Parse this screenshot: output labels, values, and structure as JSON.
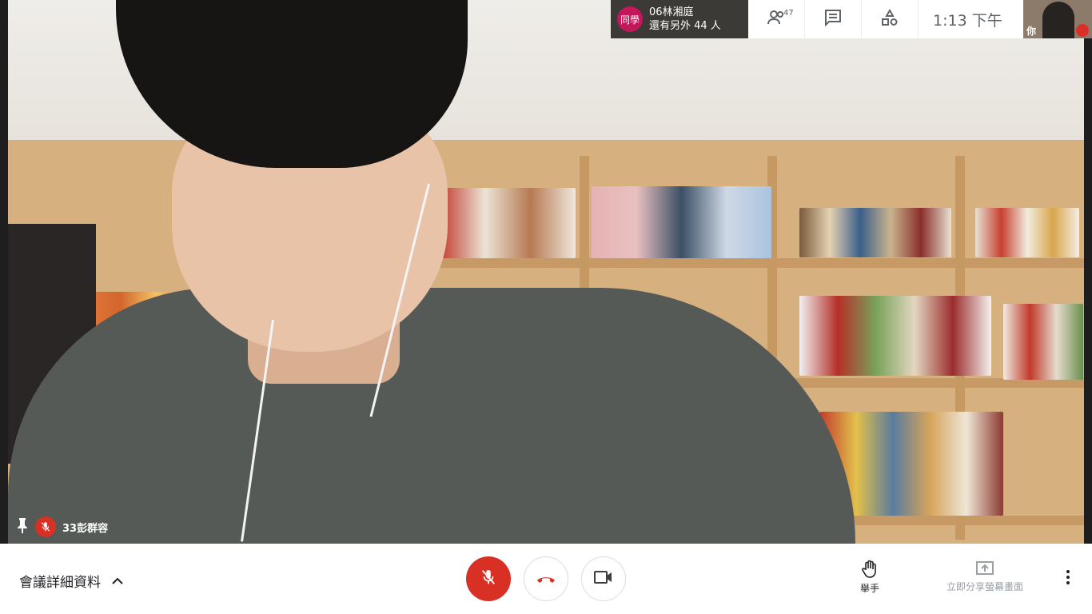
{
  "presenter": {
    "avatar_text": "同學",
    "name": "06林湘庭",
    "others": "還有另外 44 人"
  },
  "topbar": {
    "participants_count": "47",
    "time": "1:13  下午"
  },
  "self_tile": {
    "label": "你"
  },
  "main_tile": {
    "name": "33彭群容"
  },
  "bottom": {
    "meeting_details": "會議詳細資料",
    "raise_hand": "舉手",
    "share_screen": "立即分享螢幕畫面"
  },
  "colors": {
    "accent_red": "#d93025",
    "presenter_badge": "#c2185b"
  },
  "icons": {
    "people": "people-icon",
    "chat": "chat-icon",
    "activities": "activities-icon",
    "mic_off": "mic-off-icon",
    "hangup": "hangup-icon",
    "camera": "camera-icon",
    "hand": "hand-icon",
    "present": "present-icon",
    "more": "more-icon",
    "pin": "pin-icon",
    "chevron_up": "chevron-up-icon"
  }
}
